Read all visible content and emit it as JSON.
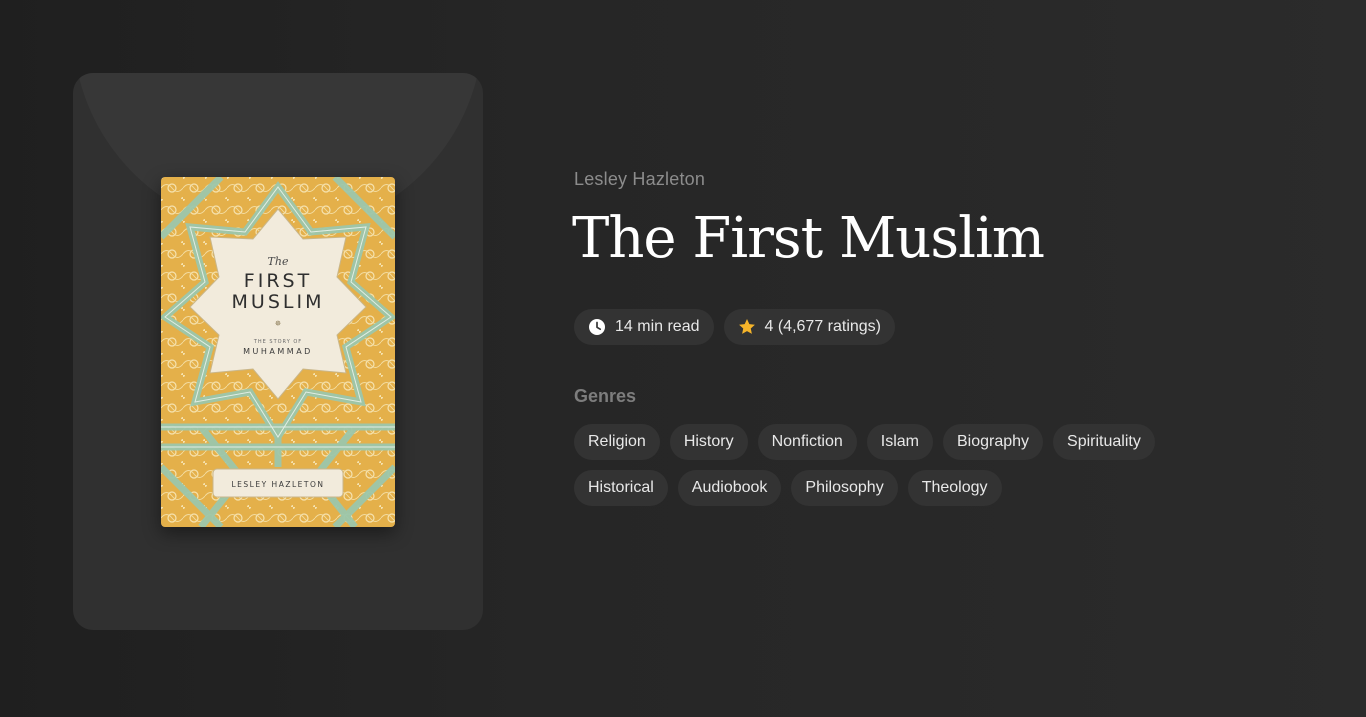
{
  "book": {
    "author": "Lesley Hazleton",
    "title": "The First Muslim",
    "read_time": "14 min read",
    "rating": "4 (4,677 ratings)",
    "cover": {
      "title_the": "The",
      "title_line1": "FIRST",
      "title_line2": "MUSLIM",
      "subtitle": "THE STORY OF",
      "subject": "MUHAMMAD",
      "author": "LESLEY HAZLETON"
    }
  },
  "meta_icons": {
    "read_time": "clock-icon",
    "rating": "star-icon"
  },
  "genres_heading": "Genres",
  "genres": [
    "Religion",
    "History",
    "Nonfiction",
    "Islam",
    "Biography",
    "Spirituality",
    "Historical",
    "Audiobook",
    "Philosophy",
    "Theology"
  ],
  "colors": {
    "background": "#262626",
    "panel": "#303030",
    "pill": "#333333",
    "star": "#f5b42a",
    "cover_gold": "#e8b64a",
    "cover_green": "#9fc9ae"
  }
}
